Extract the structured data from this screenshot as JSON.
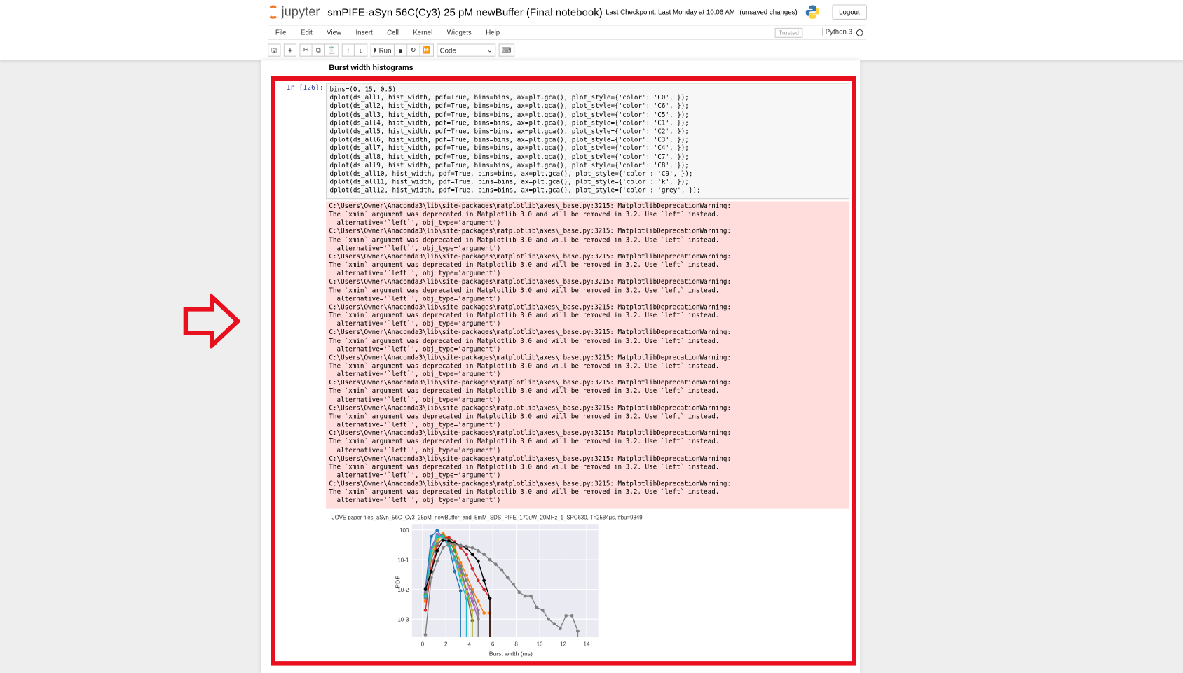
{
  "header": {
    "logo_text": "jupyter",
    "notebook_name": "smPIFE-aSyn 56C(Cy3) 25 pM newBuffer (Final notebook)",
    "checkpoint": "Last Checkpoint: Last Monday at 10:06 AM",
    "save_status": "(unsaved changes)",
    "logout_label": "Logout"
  },
  "menu": {
    "items": [
      "File",
      "Edit",
      "View",
      "Insert",
      "Cell",
      "Kernel",
      "Widgets",
      "Help"
    ],
    "trusted": "Trusted",
    "kernel": "Python 3"
  },
  "toolbar": {
    "run_label": "Run",
    "cell_type": "Code"
  },
  "notebook": {
    "markdown_heading": "Burst width histograms",
    "prompt": "In [126]:",
    "code_lines": [
      "bins=(0, 15, 0.5)",
      "dplot(ds_all1, hist_width, pdf=True, bins=bins, ax=plt.gca(), plot_style={'color': 'C0', });",
      "dplot(ds_all2, hist_width, pdf=True, bins=bins, ax=plt.gca(), plot_style={'color': 'C6', });",
      "dplot(ds_all3, hist_width, pdf=True, bins=bins, ax=plt.gca(), plot_style={'color': 'C5', });",
      "dplot(ds_all4, hist_width, pdf=True, bins=bins, ax=plt.gca(), plot_style={'color': 'C1', });",
      "dplot(ds_all5, hist_width, pdf=True, bins=bins, ax=plt.gca(), plot_style={'color': 'C2', });",
      "dplot(ds_all6, hist_width, pdf=True, bins=bins, ax=plt.gca(), plot_style={'color': 'C3', });",
      "dplot(ds_all7, hist_width, pdf=True, bins=bins, ax=plt.gca(), plot_style={'color': 'C4', });",
      "dplot(ds_all8, hist_width, pdf=True, bins=bins, ax=plt.gca(), plot_style={'color': 'C7', });",
      "dplot(ds_all9, hist_width, pdf=True, bins=bins, ax=plt.gca(), plot_style={'color': 'C8', });",
      "dplot(ds_all10, hist_width, pdf=True, bins=bins, ax=plt.gca(), plot_style={'color': 'C9', });",
      "dplot(ds_all11, hist_width, pdf=True, bins=bins, ax=plt.gca(), plot_style={'color': 'k', });",
      "dplot(ds_all12, hist_width, pdf=True, bins=bins, ax=plt.gca(), plot_style={'color': 'grey', });"
    ],
    "warning": {
      "path": "C:\\Users\\Owner\\Anaconda3\\lib\\site-packages\\matplotlib\\axes\\_base.py:3215: MatplotlibDeprecationWarning:",
      "message": "The `xmin` argument was deprecated in Matplotlib 3.0 and will be removed in 3.2. Use `left` instead.",
      "alternative": "  alternative='`left`', obj_type='argument')",
      "repeat": 12
    }
  },
  "chart_data": {
    "type": "line",
    "title": "JOVE paper files_aSyn_56C_Cy3_25pM_newBuffer_and_5mM_SDS_PIFE_170uW_20MHz_1_SPC630, T=2584μs, #bu=9349",
    "xlabel": "Burst width (ms)",
    "ylabel": "PDF",
    "xlim": [
      -0.9,
      15
    ],
    "ylim_log10": [
      -3.6,
      0.2
    ],
    "yscale": "log",
    "xticks": [
      "0",
      "2",
      "4",
      "6",
      "8",
      "10",
      "12",
      "14"
    ],
    "yticks": [
      "10^0",
      "10^-1",
      "10^-2",
      "10^-3"
    ],
    "grid": true,
    "x": [
      0.25,
      0.75,
      1.25,
      1.75,
      2.25,
      2.75,
      3.25,
      3.75,
      4.25,
      4.75,
      5.25,
      5.75,
      6.25,
      6.75,
      7.25,
      7.75,
      8.25,
      8.75,
      9.25,
      9.75,
      10.25,
      10.75,
      11.25,
      11.75,
      12.25,
      12.75,
      13.25,
      13.75
    ],
    "series": [
      {
        "name": "C0",
        "color": "#1f77b4",
        "values": [
          0.011,
          0.6,
          0.95,
          0.55,
          0.3,
          0.04,
          0.009,
          null
        ]
      },
      {
        "name": "C6",
        "color": "#e377c2",
        "values": [
          0.005,
          0.15,
          0.55,
          0.75,
          0.35,
          0.12,
          0.05,
          0.02,
          0.005,
          0.0015,
          null
        ]
      },
      {
        "name": "C5",
        "color": "#8c564b",
        "values": [
          0.006,
          0.2,
          0.6,
          0.7,
          0.3,
          0.1,
          0.03,
          0.008,
          0.0009,
          null
        ]
      },
      {
        "name": "C1",
        "color": "#ff7f0e",
        "values": [
          0.004,
          0.1,
          0.45,
          0.75,
          0.5,
          0.25,
          0.08,
          0.03,
          0.01,
          0.004,
          0.0016,
          0.0016,
          null
        ]
      },
      {
        "name": "C2",
        "color": "#2ca02c",
        "values": [
          0.007,
          0.2,
          0.55,
          0.65,
          0.45,
          0.2,
          0.05,
          0.01,
          0.002,
          null
        ]
      },
      {
        "name": "C3",
        "color": "#d62728",
        "values": [
          0.002,
          0.05,
          0.3,
          0.55,
          0.55,
          0.4,
          0.25,
          0.15,
          0.05,
          0.02,
          0.01,
          0.005,
          null
        ]
      },
      {
        "name": "C4",
        "color": "#9467bd",
        "values": [
          0.008,
          0.25,
          0.7,
          0.6,
          0.35,
          0.12,
          0.04,
          0.01,
          0.004,
          0.001,
          null
        ]
      },
      {
        "name": "C7",
        "color": "#7f7f7f",
        "values": [
          0.005,
          0.1,
          0.35,
          0.5,
          0.3,
          0.12,
          0.06,
          0.02,
          0.008,
          0.002,
          null
        ]
      },
      {
        "name": "C8",
        "color": "#bcbd22",
        "values": [
          0.006,
          0.15,
          0.5,
          0.6,
          0.3,
          0.1,
          0.03,
          0.008,
          0.002,
          null
        ]
      },
      {
        "name": "C9",
        "color": "#17becf",
        "values": [
          0.006,
          0.2,
          0.6,
          0.6,
          0.3,
          0.1,
          0.02,
          0.005,
          null
        ]
      },
      {
        "name": "k",
        "color": "#000000",
        "values": [
          0.01,
          0.04,
          0.2,
          0.45,
          0.42,
          0.35,
          0.3,
          0.25,
          0.15,
          0.09,
          0.02,
          0.005,
          null
        ]
      },
      {
        "name": "grey",
        "color": "#808080",
        "values": [
          0.0003,
          0.025,
          0.09,
          0.25,
          0.35,
          0.33,
          0.3,
          0.28,
          0.25,
          0.2,
          0.15,
          0.1,
          0.07,
          0.045,
          0.025,
          0.015,
          0.008,
          0.006,
          0.006,
          0.0025,
          0.002,
          0.001,
          0.0007,
          0.0005,
          0.0013,
          0.0013,
          0.0004,
          null
        ]
      }
    ]
  }
}
